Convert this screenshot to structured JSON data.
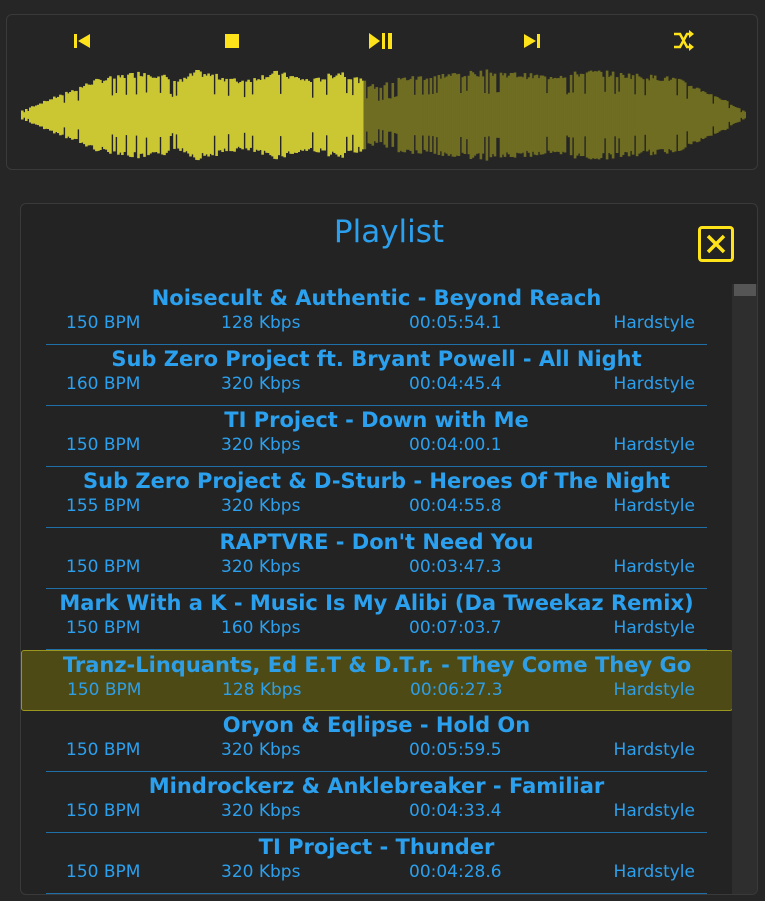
{
  "player": {
    "controls": [
      {
        "name": "previous-icon"
      },
      {
        "name": "stop-icon"
      },
      {
        "name": "play-pause-icon"
      },
      {
        "name": "next-icon"
      },
      {
        "name": "shuffle-icon"
      }
    ],
    "progress": 0.47,
    "colors": {
      "accent": "#ffe31a",
      "wave_played": "#cbc733",
      "wave_remaining": "#6f6d22"
    }
  },
  "playlist": {
    "title": "Playlist",
    "close_icon": "close-icon",
    "active_index": 6,
    "tracks": [
      {
        "title": "Noisecult & Authentic - Beyond Reach",
        "bpm": "150 BPM",
        "kbps": "128 Kbps",
        "duration": "00:05:54.1",
        "genre": "Hardstyle"
      },
      {
        "title": "Sub Zero Project ft. Bryant Powell - All Night",
        "bpm": "160 BPM",
        "kbps": "320 Kbps",
        "duration": "00:04:45.4",
        "genre": "Hardstyle"
      },
      {
        "title": "TI Project - Down with Me",
        "bpm": "150 BPM",
        "kbps": "320 Kbps",
        "duration": "00:04:00.1",
        "genre": "Hardstyle"
      },
      {
        "title": "Sub Zero Project & D-Sturb - Heroes Of The Night",
        "bpm": "155 BPM",
        "kbps": "320 Kbps",
        "duration": "00:04:55.8",
        "genre": "Hardstyle"
      },
      {
        "title": "RAPTVRE - Don't Need You",
        "bpm": "150 BPM",
        "kbps": "320 Kbps",
        "duration": "00:03:47.3",
        "genre": "Hardstyle"
      },
      {
        "title": "Mark With a K - Music Is My Alibi (Da Tweekaz Remix)",
        "bpm": "150 BPM",
        "kbps": "160 Kbps",
        "duration": "00:07:03.7",
        "genre": "Hardstyle"
      },
      {
        "title": "Tranz-Linquants, Ed E.T & D.T.r. - They Come They Go",
        "bpm": "150 BPM",
        "kbps": "128 Kbps",
        "duration": "00:06:27.3",
        "genre": "Hardstyle"
      },
      {
        "title": "Oryon & Eqlipse - Hold On",
        "bpm": "150 BPM",
        "kbps": "320 Kbps",
        "duration": "00:05:59.5",
        "genre": "Hardstyle"
      },
      {
        "title": "Mindrockerz & Anklebreaker - Familiar",
        "bpm": "150 BPM",
        "kbps": "320 Kbps",
        "duration": "00:04:33.4",
        "genre": "Hardstyle"
      },
      {
        "title": "TI Project - Thunder",
        "bpm": "150 BPM",
        "kbps": "320 Kbps",
        "duration": "00:04:28.6",
        "genre": "Hardstyle"
      }
    ]
  }
}
